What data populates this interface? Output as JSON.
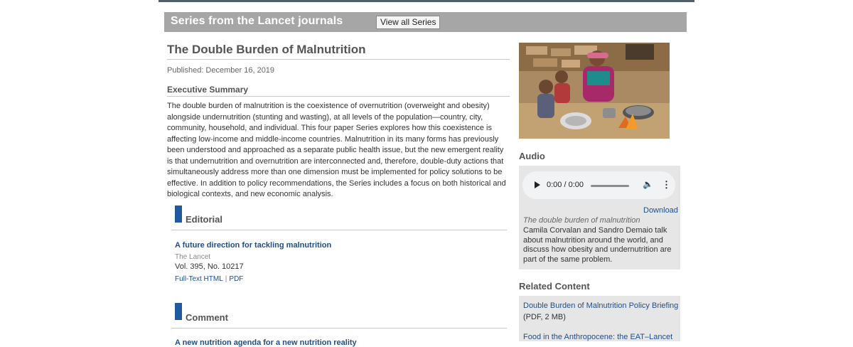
{
  "header": {
    "series_title": "Series from the Lancet journals",
    "view_all_label": "View all Series"
  },
  "article": {
    "title": "The Double Burden of Malnutrition",
    "published": "Published: December 16, 2019",
    "exec_heading": "Executive Summary",
    "exec_text": "The double burden of malnutrition is the coexistence of overnutrition (overweight and obesity) alongside undernutrition (stunting and wasting), at all levels of the population—country, city, community, household, and individual. This four paper Series explores how this coexistence is affecting low-income and middle-income countries. Malnutrition in its many forms has previously been understood and approached as a separate public health issue, but the new emergent reality is that undernutrition and overnutrition are interconnected and, therefore, double-duty actions that simultaneously address more than one dimension must be implemented for policy solutions to be effective. In addition to policy recommendations, the Series includes a focus on both historical and biological contexts, and new economic analysis."
  },
  "sections": {
    "editorial": {
      "title": "Editorial",
      "item": {
        "title": "A future direction for tackling malnutrition",
        "journal": "The Lancet",
        "volume": "Vol. 395, No. 10217",
        "link_fulltext": "Full-Text HTML",
        "link_sep": "|",
        "link_pdf": "PDF"
      }
    },
    "comment": {
      "title": "Comment",
      "item_title_partial": "A new nutrition agenda for a new nutrition reality"
    }
  },
  "sidebar": {
    "audio_heading": "Audio",
    "player_time": "0:00 / 0:00",
    "download_label": "Download",
    "audio_caption": "The double burden of malnutrition",
    "audio_description": "Camila Corvalan and Sandro Demaio talk about malnutrition around the world, and discuss how obesity and undernutrition are part of the same problem.",
    "related_heading": "Related Content",
    "related_items": [
      {
        "title": "Double Burden of Malnutrition Policy Briefing",
        "meta": "(PDF, 2 MB)"
      },
      {
        "title": "Food in the Anthropocene: the EAT–Lancet"
      }
    ]
  },
  "colors": {
    "accent_blue": "#1f5aa0",
    "link_blue": "#1f4e8a",
    "header_gray": "#a6a6a6",
    "box_gray": "#e6e6e6"
  },
  "icons": [
    "play-icon",
    "volume-icon",
    "more-options-icon"
  ]
}
